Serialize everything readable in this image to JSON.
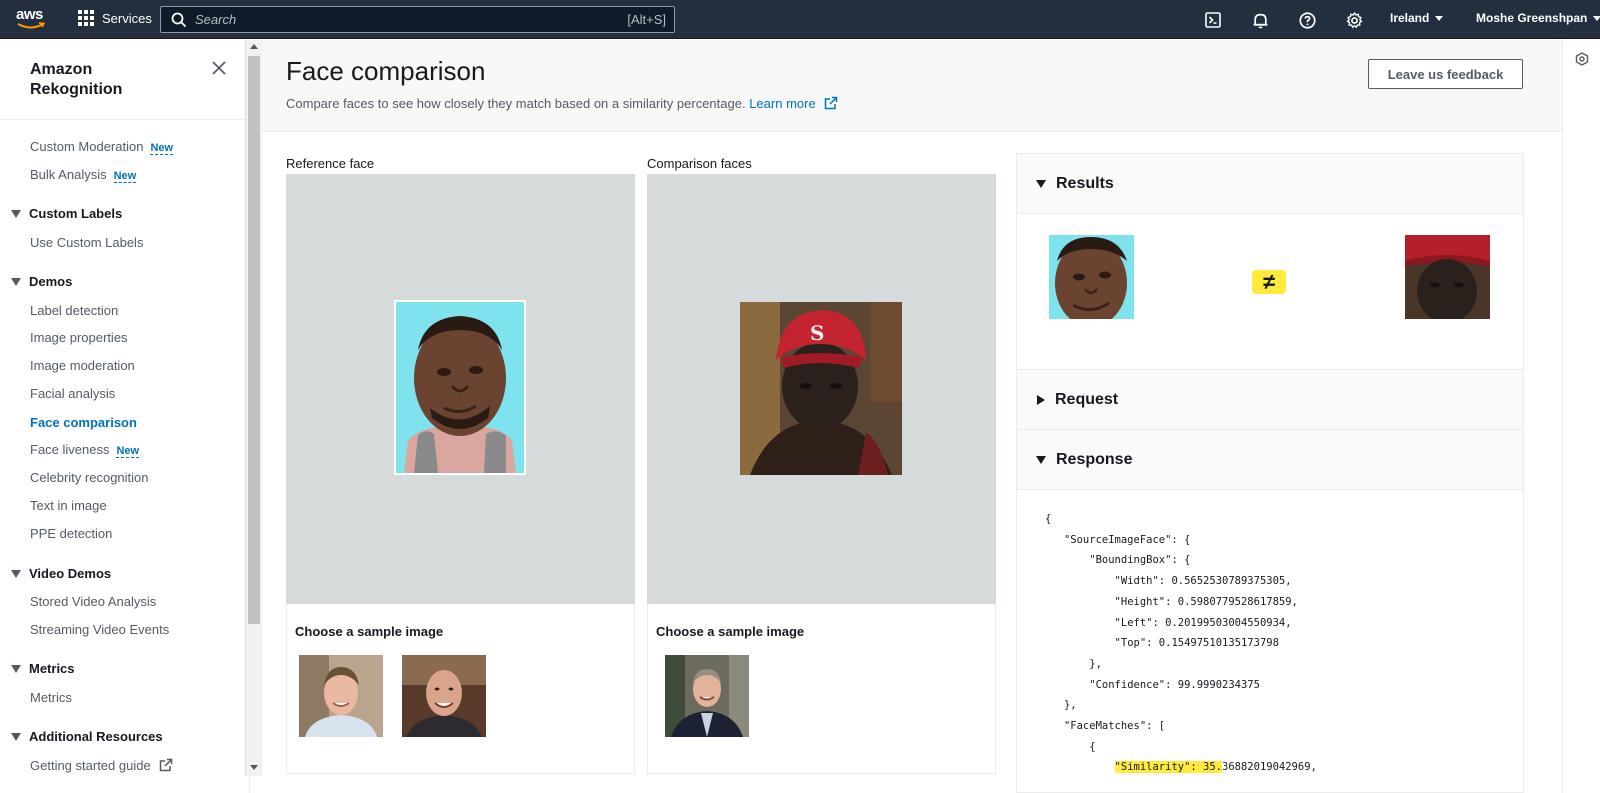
{
  "topnav": {
    "logo": "aws",
    "services_label": "Services",
    "search_placeholder": "Search",
    "search_shortcut": "[Alt+S]",
    "region": "Ireland",
    "user": "Moshe Greenshpan",
    "icons": [
      "cloudshell-icon",
      "bell-icon",
      "help-icon",
      "settings-icon"
    ]
  },
  "sidebar": {
    "title": "Amazon Rekognition",
    "new_badge": "New",
    "top_links": [
      {
        "label": "Custom Moderation",
        "new": true
      },
      {
        "label": "Bulk Analysis",
        "new": true
      }
    ],
    "sections": [
      {
        "title": "Custom Labels",
        "items": [
          "Use Custom Labels"
        ]
      },
      {
        "title": "Demos",
        "items": [
          "Label detection",
          "Image properties",
          "Image moderation",
          "Facial analysis",
          "Face comparison",
          "Face liveness",
          "Celebrity recognition",
          "Text in image",
          "PPE detection"
        ]
      },
      {
        "title": "Video Demos",
        "items": [
          "Stored Video Analysis",
          "Streaming Video Events"
        ]
      },
      {
        "title": "Metrics",
        "items": [
          "Metrics"
        ]
      },
      {
        "title": "Additional Resources",
        "items": [
          "Getting started guide"
        ]
      }
    ],
    "active_item": "Face comparison"
  },
  "header": {
    "title": "Face comparison",
    "description": "Compare faces to see how closely they match based on a similarity percentage.",
    "learn_more": "Learn more",
    "feedback_button": "Leave us feedback"
  },
  "reference": {
    "label": "Reference face",
    "sample_title": "Choose a sample image"
  },
  "comparison": {
    "label": "Comparison faces",
    "sample_title": "Choose a sample image"
  },
  "results": {
    "results_label": "Results",
    "match_symbol": "≠",
    "request_label": "Request",
    "response_label": "Response"
  },
  "response_json": {
    "open_brace": "{",
    "source_key": "\"SourceImageFace\": {",
    "bbox_key": "\"BoundingBox\": {",
    "width": "\"Width\": 0.5652530789375305,",
    "height": "\"Height\": 0.5980779528617859,",
    "left": "\"Left\": 0.20199503004550934,",
    "top": "\"Top\": 0.15497510135173798",
    "close_bbox": "},",
    "confidence": "\"Confidence\": 99.9990234375",
    "close_source": "},",
    "facematches_key": "\"FaceMatches\": [",
    "open_match": "{",
    "similarity_key": "\"Similarity\": 35.",
    "similarity_rest": "36882019042969,"
  },
  "colors": {
    "nav_bg": "#232f3e",
    "link_blue": "#0073bb",
    "highlight": "#ffeb3b",
    "image_panel": "#d5dbdb"
  }
}
